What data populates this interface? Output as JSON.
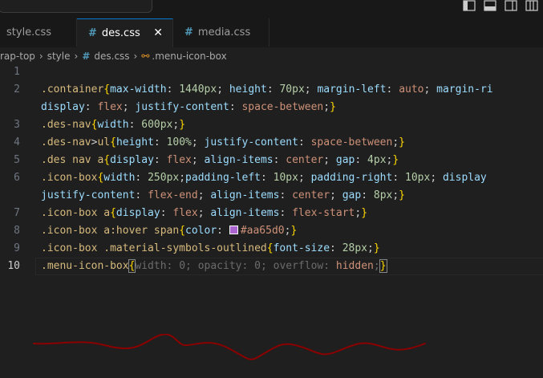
{
  "tabs": [
    {
      "label": "style.css",
      "has_icon": false,
      "active": false
    },
    {
      "label": "des.css",
      "has_icon": true,
      "active": true
    },
    {
      "label": "media.css",
      "has_icon": true,
      "active": false
    }
  ],
  "breadcrumb": {
    "items": [
      "rap-top",
      "style",
      "des.css",
      ".menu-icon-box"
    ]
  },
  "editor": {
    "line_numbers": [
      "1",
      "2",
      "",
      "3",
      "4",
      "5",
      "6",
      "",
      "7",
      "8",
      "9",
      "10"
    ],
    "active_line": "10",
    "color_swatch": "#aa65d0",
    "squiggle_color": "#8b0000",
    "lines": [
      [],
      [
        {
          "t": ".container",
          "c": "sel"
        },
        {
          "t": "{",
          "c": "brace"
        },
        {
          "t": "max-width",
          "c": "prop"
        },
        {
          "t": ": ",
          "c": "txt"
        },
        {
          "t": "1440",
          "c": "num"
        },
        {
          "t": "px",
          "c": "unit"
        },
        {
          "t": "; ",
          "c": "txt"
        },
        {
          "t": "height",
          "c": "prop"
        },
        {
          "t": ": ",
          "c": "txt"
        },
        {
          "t": "70",
          "c": "num"
        },
        {
          "t": "px",
          "c": "unit"
        },
        {
          "t": "; ",
          "c": "txt"
        },
        {
          "t": "margin-left",
          "c": "prop"
        },
        {
          "t": ": ",
          "c": "txt"
        },
        {
          "t": "auto",
          "c": "kw"
        },
        {
          "t": "; ",
          "c": "txt"
        },
        {
          "t": "margin-ri",
          "c": "prop"
        }
      ],
      [
        {
          "t": "display",
          "c": "prop"
        },
        {
          "t": ": ",
          "c": "txt"
        },
        {
          "t": "flex",
          "c": "kw"
        },
        {
          "t": "; ",
          "c": "txt"
        },
        {
          "t": "justify-content",
          "c": "prop"
        },
        {
          "t": ": ",
          "c": "txt"
        },
        {
          "t": "space-between",
          "c": "kw"
        },
        {
          "t": ";",
          "c": "txt"
        },
        {
          "t": "}",
          "c": "brace"
        }
      ],
      [
        {
          "t": ".des-nav",
          "c": "sel"
        },
        {
          "t": "{",
          "c": "brace"
        },
        {
          "t": "width",
          "c": "prop"
        },
        {
          "t": ": ",
          "c": "txt"
        },
        {
          "t": "600",
          "c": "num"
        },
        {
          "t": "px",
          "c": "unit"
        },
        {
          "t": ";",
          "c": "txt"
        },
        {
          "t": "}",
          "c": "brace"
        }
      ],
      [
        {
          "t": ".des-nav",
          "c": "sel"
        },
        {
          "t": ">",
          "c": "txt"
        },
        {
          "t": "ul",
          "c": "sel"
        },
        {
          "t": "{",
          "c": "brace"
        },
        {
          "t": "height",
          "c": "prop"
        },
        {
          "t": ": ",
          "c": "txt"
        },
        {
          "t": "100",
          "c": "num"
        },
        {
          "t": "%",
          "c": "unit"
        },
        {
          "t": "; ",
          "c": "txt"
        },
        {
          "t": "justify-content",
          "c": "prop"
        },
        {
          "t": ": ",
          "c": "txt"
        },
        {
          "t": "space-between",
          "c": "kw"
        },
        {
          "t": ";",
          "c": "txt"
        },
        {
          "t": "}",
          "c": "brace"
        }
      ],
      [
        {
          "t": ".des nav a",
          "c": "sel"
        },
        {
          "t": "{",
          "c": "brace"
        },
        {
          "t": "display",
          "c": "prop"
        },
        {
          "t": ": ",
          "c": "txt"
        },
        {
          "t": "flex",
          "c": "kw"
        },
        {
          "t": "; ",
          "c": "txt"
        },
        {
          "t": "align-items",
          "c": "prop"
        },
        {
          "t": ": ",
          "c": "txt"
        },
        {
          "t": "center",
          "c": "kw"
        },
        {
          "t": "; ",
          "c": "txt"
        },
        {
          "t": "gap",
          "c": "prop"
        },
        {
          "t": ": ",
          "c": "txt"
        },
        {
          "t": "4",
          "c": "num"
        },
        {
          "t": "px",
          "c": "unit"
        },
        {
          "t": ";",
          "c": "txt"
        },
        {
          "t": "}",
          "c": "brace"
        }
      ],
      [
        {
          "t": ".icon-box",
          "c": "sel"
        },
        {
          "t": "{",
          "c": "brace"
        },
        {
          "t": "width",
          "c": "prop"
        },
        {
          "t": ": ",
          "c": "txt"
        },
        {
          "t": "250",
          "c": "num"
        },
        {
          "t": "px",
          "c": "unit"
        },
        {
          "t": ";",
          "c": "txt"
        },
        {
          "t": "padding-left",
          "c": "prop"
        },
        {
          "t": ": ",
          "c": "txt"
        },
        {
          "t": "10",
          "c": "num"
        },
        {
          "t": "px",
          "c": "unit"
        },
        {
          "t": "; ",
          "c": "txt"
        },
        {
          "t": "padding-right",
          "c": "prop"
        },
        {
          "t": ": ",
          "c": "txt"
        },
        {
          "t": "10",
          "c": "num"
        },
        {
          "t": "px",
          "c": "unit"
        },
        {
          "t": "; ",
          "c": "txt"
        },
        {
          "t": "display",
          "c": "prop"
        }
      ],
      [
        {
          "t": "justify-content",
          "c": "prop"
        },
        {
          "t": ": ",
          "c": "txt"
        },
        {
          "t": "flex-end",
          "c": "kw"
        },
        {
          "t": "; ",
          "c": "txt"
        },
        {
          "t": "align-items",
          "c": "prop"
        },
        {
          "t": ": ",
          "c": "txt"
        },
        {
          "t": "center",
          "c": "kw"
        },
        {
          "t": "; ",
          "c": "txt"
        },
        {
          "t": "gap",
          "c": "prop"
        },
        {
          "t": ": ",
          "c": "txt"
        },
        {
          "t": "8",
          "c": "num"
        },
        {
          "t": "px",
          "c": "unit"
        },
        {
          "t": ";",
          "c": "txt"
        },
        {
          "t": "}",
          "c": "brace"
        }
      ],
      [
        {
          "t": ".icon-box a",
          "c": "sel"
        },
        {
          "t": "{",
          "c": "brace"
        },
        {
          "t": "display",
          "c": "prop"
        },
        {
          "t": ": ",
          "c": "txt"
        },
        {
          "t": "flex",
          "c": "kw"
        },
        {
          "t": "; ",
          "c": "txt"
        },
        {
          "t": "align-items",
          "c": "prop"
        },
        {
          "t": ": ",
          "c": "txt"
        },
        {
          "t": "flex-start",
          "c": "kw"
        },
        {
          "t": ";",
          "c": "txt"
        },
        {
          "t": "}",
          "c": "brace"
        }
      ],
      [
        {
          "t": ".icon-box a:hover span",
          "c": "sel"
        },
        {
          "t": "{",
          "c": "brace"
        },
        {
          "t": "color",
          "c": "prop"
        },
        {
          "t": ": ",
          "c": "txt"
        },
        {
          "t": "",
          "c": "swatch"
        },
        {
          "t": "#aa65d0",
          "c": "kw"
        },
        {
          "t": ";",
          "c": "txt"
        },
        {
          "t": "}",
          "c": "brace"
        }
      ],
      [
        {
          "t": ".icon-box .material-symbols-outlined",
          "c": "sel"
        },
        {
          "t": "{",
          "c": "brace"
        },
        {
          "t": "font-size",
          "c": "prop"
        },
        {
          "t": ": ",
          "c": "txt"
        },
        {
          "t": "28",
          "c": "num"
        },
        {
          "t": "px",
          "c": "unit"
        },
        {
          "t": ";",
          "c": "txt"
        },
        {
          "t": "}",
          "c": "brace"
        }
      ],
      [
        {
          "t": ".menu-icon-box",
          "c": "sel"
        },
        {
          "t": "{",
          "c": "brace cursor-brace"
        },
        {
          "t": "width",
          "c": "dim"
        },
        {
          "t": ": ",
          "c": "dim"
        },
        {
          "t": "0",
          "c": "dim"
        },
        {
          "t": "; ",
          "c": "dim"
        },
        {
          "t": "opacity",
          "c": "dim"
        },
        {
          "t": ": ",
          "c": "dim"
        },
        {
          "t": "0",
          "c": "dim"
        },
        {
          "t": "; ",
          "c": "dim"
        },
        {
          "t": "overflow",
          "c": "dim"
        },
        {
          "t": ": ",
          "c": "dim"
        },
        {
          "t": "hidden",
          "c": "kw"
        },
        {
          "t": ";",
          "c": "dim"
        },
        {
          "t": "}",
          "c": "brace cursor-brace"
        }
      ]
    ]
  }
}
